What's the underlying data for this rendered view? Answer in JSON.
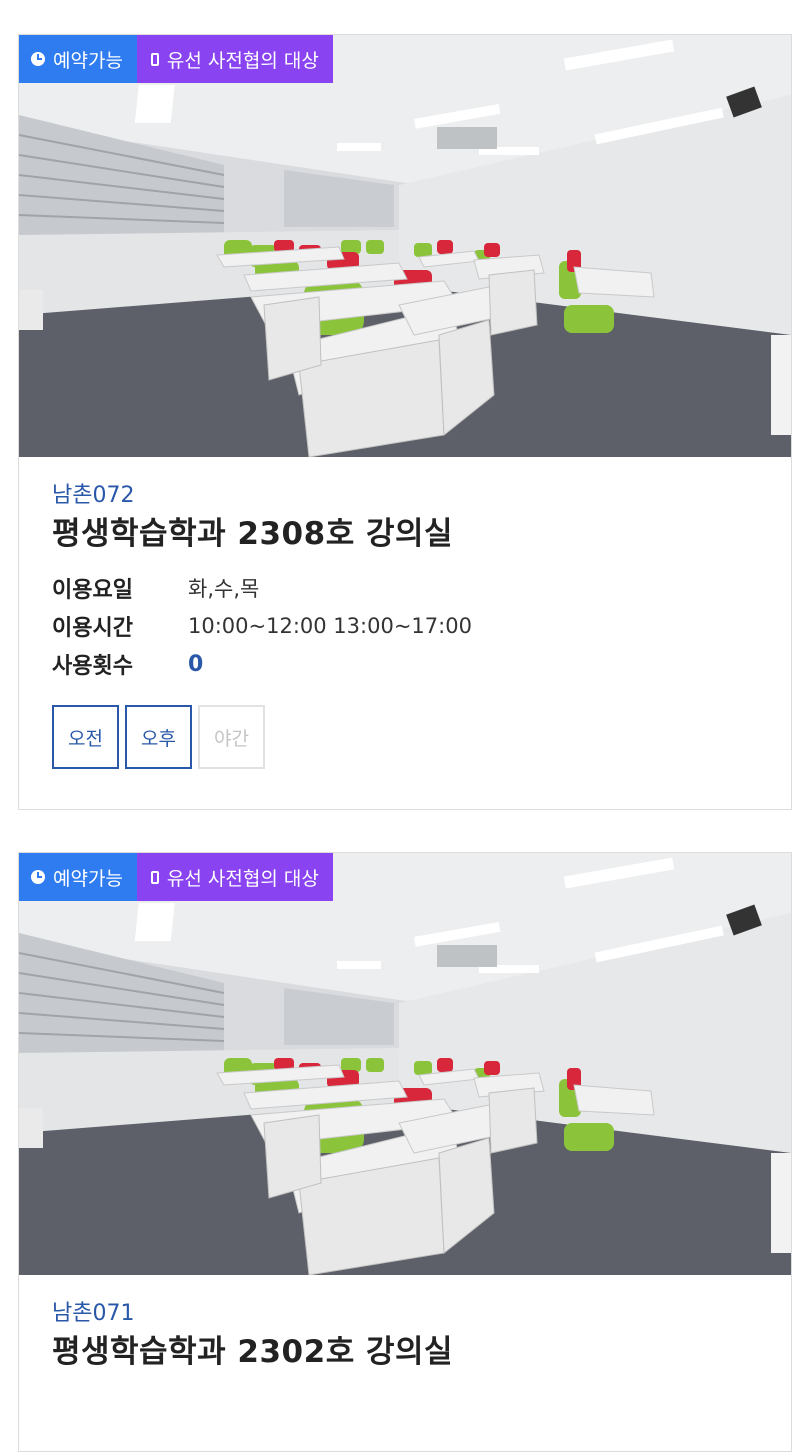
{
  "badges": {
    "available": "예약가능",
    "wired": "유선 사전협의 대상",
    "available_icon": "clock-icon",
    "wired_icon": "phone-icon"
  },
  "rooms": [
    {
      "code": "남촌072",
      "title": "평생학습학과 2308호 강의실",
      "days_label": "이용요일",
      "days": "화,수,목",
      "hours_label": "이용시간",
      "hours": "10:00~12:00 13:00~17:00",
      "count_label": "사용횟수",
      "count": "0",
      "slots": [
        {
          "label": "오전",
          "enabled": true
        },
        {
          "label": "오후",
          "enabled": true
        },
        {
          "label": "야간",
          "enabled": false
        }
      ]
    },
    {
      "code": "남촌071",
      "title": "평생학습학과 2302호 강의실"
    }
  ],
  "colors": {
    "available": "#2f7bf0",
    "wired": "#8a43f0",
    "accent": "#2a58a8"
  }
}
